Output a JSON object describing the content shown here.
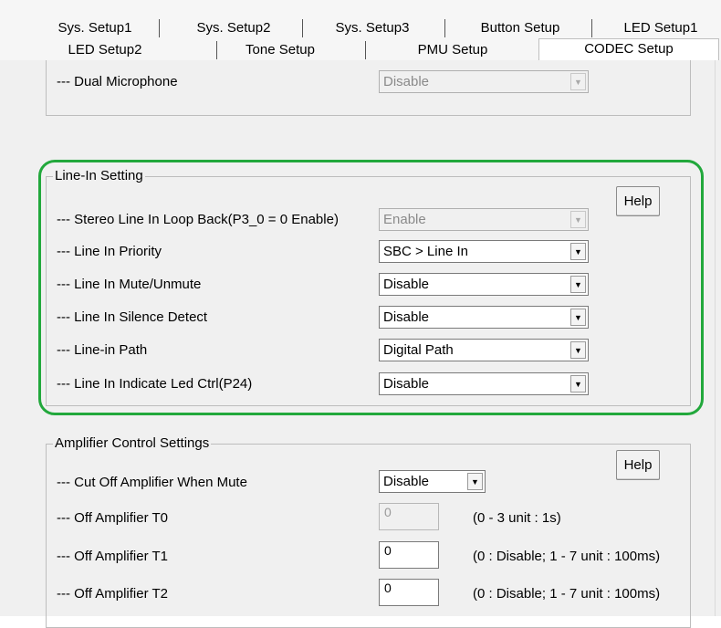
{
  "tabs": {
    "row1": [
      "Sys. Setup1",
      "Sys. Setup2",
      "Sys. Setup3",
      "Button Setup",
      "LED Setup1"
    ],
    "row2": [
      "LED Setup2",
      "Tone Setup",
      "PMU Setup",
      "CODEC Setup"
    ],
    "active": "CODEC Setup"
  },
  "top_section": {
    "dual_mic_label": "--- Dual Microphone",
    "dual_mic_value": "Disable"
  },
  "line_in": {
    "title": "Line-In Setting",
    "help": "Help",
    "rows": [
      {
        "label": "--- Stereo Line In Loop Back(P3_0 = 0 Enable)",
        "value": "Enable"
      },
      {
        "label": "--- Line In Priority",
        "value": "SBC > Line In"
      },
      {
        "label": "--- Line In Mute/Unmute",
        "value": "Disable"
      },
      {
        "label": "--- Line In Silence Detect",
        "value": "Disable"
      },
      {
        "label": "--- Line-in Path",
        "value": "Digital Path"
      },
      {
        "label": "--- Line In Indicate Led Ctrl(P24)",
        "value": "Disable"
      }
    ]
  },
  "amp": {
    "title": "Amplifier Control Settings",
    "help": "Help",
    "cut_off_label": "--- Cut Off Amplifier When Mute",
    "cut_off_value": "Disable",
    "t0_label": "--- Off Amplifier T0",
    "t0_value": "0",
    "t0_hint": "(0 - 3 unit : 1s)",
    "t1_label": "--- Off Amplifier T1",
    "t1_value": "0",
    "t1_hint": "(0 : Disable; 1 - 7 unit : 100ms)",
    "t2_label": "--- Off Amplifier T2",
    "t2_value": "0",
    "t2_hint": "(0 : Disable; 1 - 7 unit : 100ms)"
  },
  "colors": {
    "highlight": "#22a83c"
  }
}
